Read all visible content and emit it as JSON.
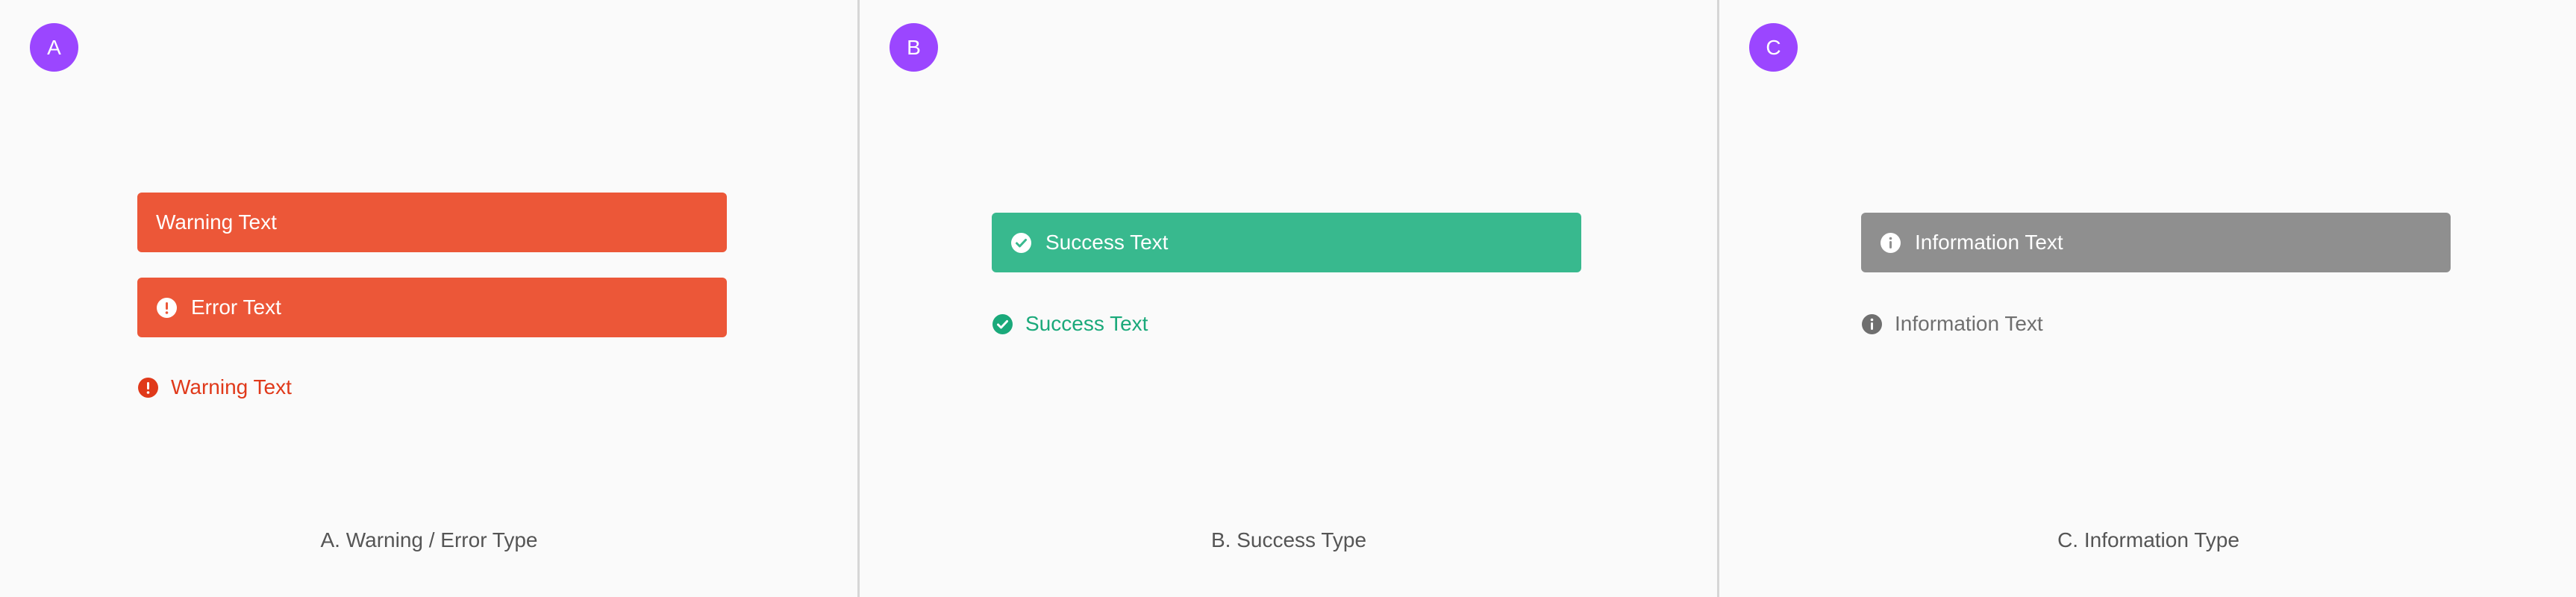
{
  "colors": {
    "badge": "#9b46ff",
    "error": "#ec5738",
    "error_text": "#e0391a",
    "success": "#38b98e",
    "success_text": "#1aa97a",
    "info": "#8f8f8f",
    "info_text": "#6f6f6f",
    "caption": "#555555",
    "background": "#fafafa"
  },
  "panels": [
    {
      "badge": "A",
      "banners": [
        {
          "text": "Warning Text",
          "icon": null
        },
        {
          "text": "Error Text",
          "icon": "exclamation-circle-icon"
        }
      ],
      "inline": {
        "text": "Warning Text",
        "icon": "exclamation-circle-icon"
      },
      "caption": "A. Warning / Error Type"
    },
    {
      "badge": "B",
      "banners": [
        {
          "text": "Success Text",
          "icon": "check-circle-icon"
        }
      ],
      "inline": {
        "text": "Success Text",
        "icon": "check-circle-icon"
      },
      "caption": "B. Success Type"
    },
    {
      "badge": "C",
      "banners": [
        {
          "text": "Information Text",
          "icon": "info-circle-icon"
        }
      ],
      "inline": {
        "text": "Information Text",
        "icon": "info-circle-icon"
      },
      "caption": "C. Information Type"
    }
  ]
}
